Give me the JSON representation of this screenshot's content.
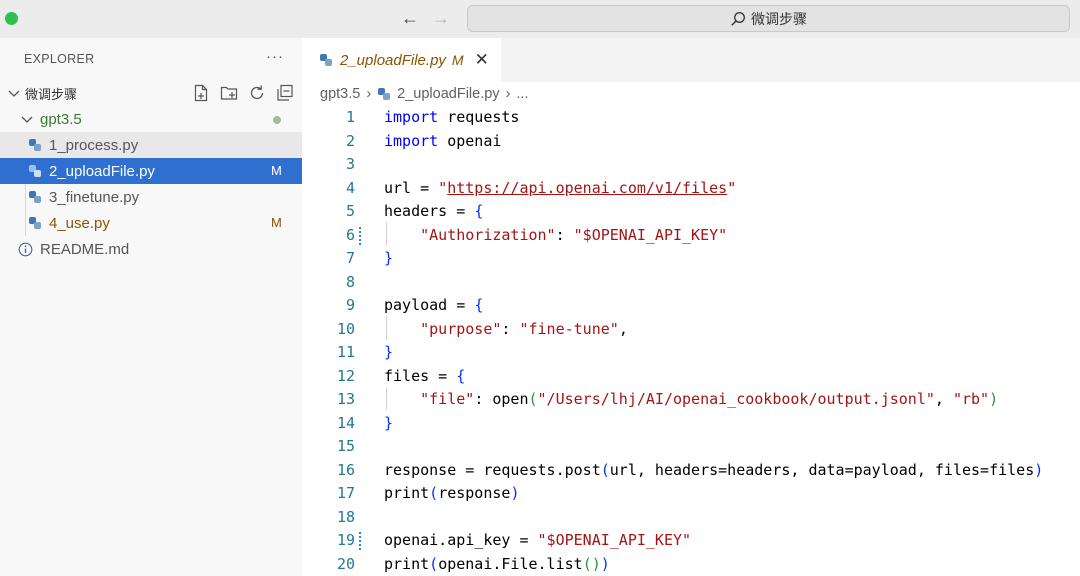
{
  "titlebar": {
    "search_text": "微调步骤"
  },
  "explorer": {
    "header": "EXPLORER",
    "more": "···",
    "root_folder": "微调步骤",
    "subfolder": "gpt3.5",
    "files": [
      {
        "name": "1_process.py",
        "badge": ""
      },
      {
        "name": "2_uploadFile.py",
        "badge": "M"
      },
      {
        "name": "3_finetune.py",
        "badge": ""
      },
      {
        "name": "4_use.py",
        "badge": "M"
      }
    ],
    "readme": "README.md"
  },
  "editor": {
    "tab_label": "2_uploadFile.py",
    "tab_badge": "M",
    "breadcrumb": [
      "gpt3.5",
      "2_uploadFile.py",
      "..."
    ],
    "line_numbers": [
      "1",
      "2",
      "3",
      "4",
      "5",
      "6",
      "7",
      "8",
      "9",
      "10",
      "11",
      "12",
      "13",
      "14",
      "15",
      "16",
      "17",
      "18",
      "19",
      "20"
    ],
    "lines": [
      "import requests",
      "import openai",
      "",
      "url = \"https://api.openai.com/v1/files\"",
      "headers = {",
      "    \"Authorization\": \"$OPENAI_API_KEY\"",
      "}",
      "",
      "payload = {",
      "    \"purpose\": \"fine-tune\",",
      "}",
      "files = {",
      "    \"file\": open(\"/Users/lhj/AI/openai_cookbook/output.jsonl\", \"rb\")",
      "}",
      "",
      "response = requests.post(url, headers=headers, data=payload, files=files)",
      "print(response)",
      "",
      "openai.api_key = \"$OPENAI_API_KEY\"",
      "print(openai.File.list())"
    ]
  },
  "colors": {
    "accent_selection": "#2e6fcf",
    "modified": "#895503",
    "folder_green": "#3a7a34",
    "keyword": "#0000ff",
    "string": "#a31515",
    "line_number": "#237893"
  }
}
